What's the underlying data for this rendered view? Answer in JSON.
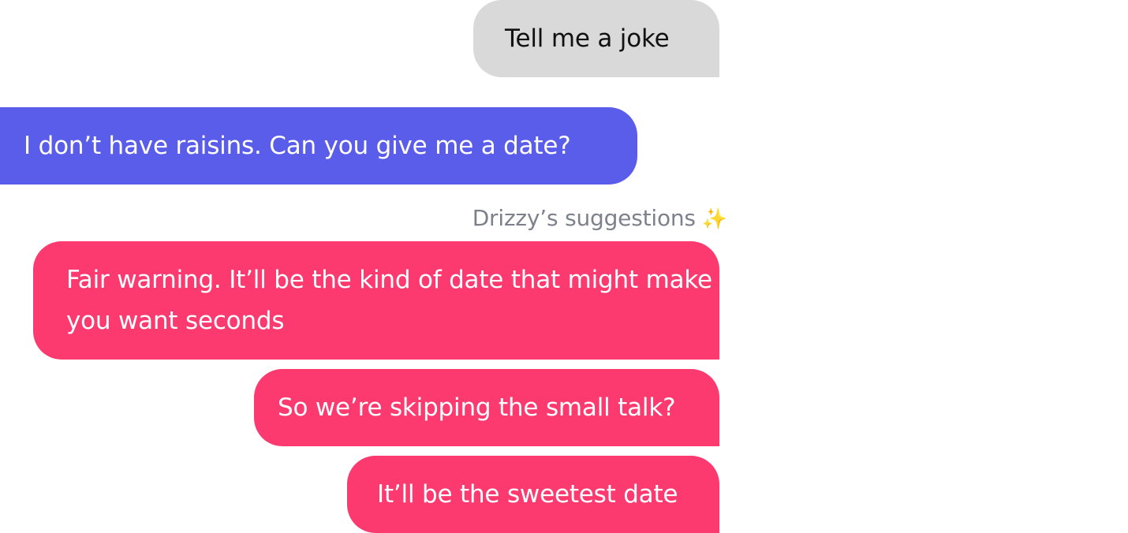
{
  "conversation": {
    "outgoing_message": "Tell me a joke",
    "incoming_message": "I don’t have raisins. Can you give me a date?"
  },
  "suggestions": {
    "header": "Drizzy’s suggestions",
    "header_icon": "sparkles-icon",
    "items": [
      "Fair warning. It’ll be the kind of date that might make you want seconds",
      "So we’re skipping the small talk?",
      "It’ll be the sweetest date"
    ]
  },
  "colors": {
    "outgoing_bubble": "#d9d9d9",
    "incoming_bubble": "#5a5de9",
    "suggestion_bubble": "#fd3a70",
    "header_text": "#7d818b",
    "sparkle": "#f5c62c"
  }
}
